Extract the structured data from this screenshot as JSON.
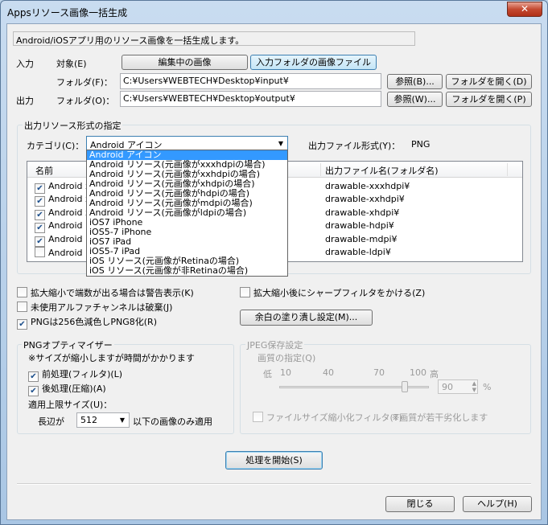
{
  "window": {
    "title": "Appsリソース画像一括生成",
    "close_glyph": "✕"
  },
  "description": "Android/iOSアプリ用のリソース画像を一括生成します。",
  "input": {
    "section_label": "入力",
    "target_label": "対象(E)",
    "target_editing": "編集中の画像",
    "target_folder": "入力フォルダの画像ファイル",
    "folder_label": "フォルダ(F)：",
    "folder_path": "C:¥Users¥WEBTECH¥Desktop¥input¥",
    "browse_button": "参照(B)...",
    "open_button": "フォルダを開く(D)"
  },
  "output": {
    "section_label": "出力",
    "folder_label": "フォルダ(O)：",
    "folder_path": "C:¥Users¥WEBTECH¥Desktop¥output¥",
    "browse_button": "参照(W)...",
    "open_button": "フォルダを開く(P)"
  },
  "format_group": {
    "label": "出力リソース形式の指定",
    "category_label": "カテゴリ(C)：",
    "category_value": "Android アイコン",
    "file_format_label": "出力ファイル形式(Y)：",
    "file_format_value": "PNG",
    "columns": {
      "name": "名前",
      "filename": "出力ファイル名(フォルダ名)"
    },
    "rows": [
      {
        "name": "Android x",
        "checked": true,
        "folder": "drawable-xxxhdpi¥"
      },
      {
        "name": "Android x",
        "checked": true,
        "folder": "drawable-xxhdpi¥"
      },
      {
        "name": "Android x",
        "checked": true,
        "folder": "drawable-xhdpi¥"
      },
      {
        "name": "Android h",
        "checked": true,
        "folder": "drawable-hdpi¥"
      },
      {
        "name": "Android m",
        "checked": true,
        "folder": "drawable-mdpi¥"
      },
      {
        "name": "Android l",
        "checked": false,
        "folder": "drawable-ldpi¥"
      }
    ],
    "dropdown_options": [
      "Android アイコン",
      "Android リソース(元画像がxxxhdpiの場合)",
      "Android リソース(元画像がxxhdpiの場合)",
      "Android リソース(元画像がxhdpiの場合)",
      "Android リソース(元画像がhdpiの場合)",
      "Android リソース(元画像がmdpiの場合)",
      "Android リソース(元画像がldpiの場合)",
      "iOS7 iPhone",
      "iOS5-7 iPhone",
      "iOS7 iPad",
      "iOS5-7 iPad",
      "iOS リソース(元画像がRetinaの場合)",
      "iOS リソース(元画像が非Retinaの場合)"
    ]
  },
  "options": {
    "warn_fraction": "拡大縮小で端数が出る場合は警告表示(K)",
    "discard_alpha": "未使用アルファチャンネルは破棄(J)",
    "png8": "PNGは256色減色しPNG8化(R)",
    "sharpen": "拡大縮小後にシャープフィルタをかける(Z)",
    "margin_button": "余白の塗り潰し設定(M)..."
  },
  "png_opt": {
    "label": "PNGオプティマイザー",
    "note": "※サイズが縮小しますが時間がかかります",
    "pre": "前処理(フィルタ)(L)",
    "post": "後処理(圧縮)(A)",
    "limit_label": "適用上限サイズ(U)：",
    "long_side": "長辺が",
    "size_value": "512",
    "suffix": "以下の画像のみ適用"
  },
  "jpeg": {
    "label": "JPEG保存設定",
    "quality_label": "画質の指定(Q)",
    "low": "低",
    "high": "高",
    "ticks": [
      "10",
      "40",
      "70",
      "100"
    ],
    "quality_value": "90",
    "percent": "%",
    "filter_label": "ファイルサイズ縮小化フィルタ(T)",
    "filter_note": "※画質が若干劣化します"
  },
  "actions": {
    "start": "処理を開始(S)",
    "close": "閉じる",
    "help": "ヘルプ(H)"
  }
}
